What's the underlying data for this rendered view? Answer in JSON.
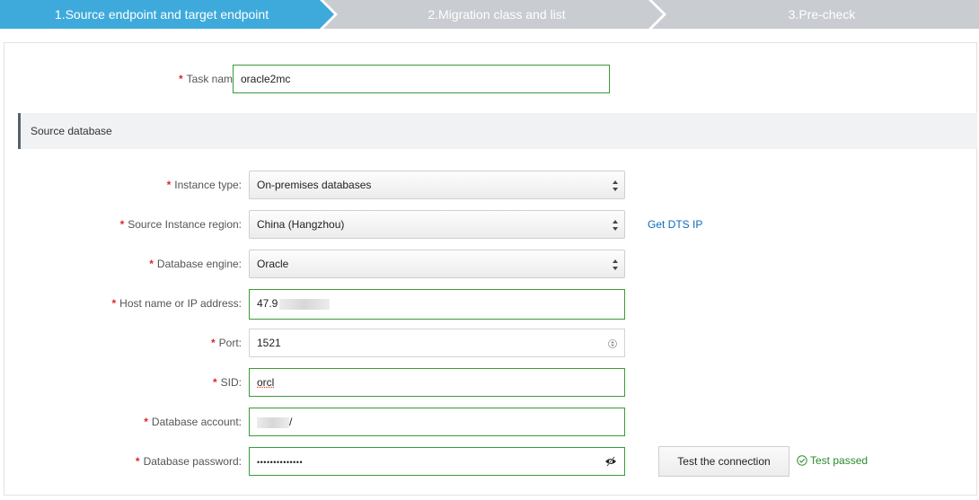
{
  "steps": [
    {
      "label": "1.Source endpoint and target endpoint",
      "state": "active"
    },
    {
      "label": "2.Migration class and list",
      "state": "inactive"
    },
    {
      "label": "3.Pre-check",
      "state": "inactive"
    }
  ],
  "colors": {
    "step_active": "#3eaadb",
    "step_inactive": "#c9ccd1",
    "ok_border": "#3a9b3a",
    "link": "#0a6bbf",
    "required": "#e0262b"
  },
  "form": {
    "required_mark": "*",
    "task_name": {
      "label": "Task name:",
      "value": "oracle2mc"
    },
    "section_title": "Source database",
    "instance_type": {
      "label": "Instance type:",
      "value": "On-premises databases"
    },
    "region": {
      "label": "Source Instance region:",
      "value": "China (Hangzhou)",
      "link": "Get DTS IP"
    },
    "engine": {
      "label": "Database engine:",
      "value": "Oracle"
    },
    "host": {
      "label": "Host name or IP address:",
      "value": "47.9"
    },
    "port": {
      "label": "Port:",
      "value": "1521"
    },
    "sid": {
      "label": "SID:",
      "value": "orcl"
    },
    "account": {
      "label": "Database account:",
      "value": "/"
    },
    "password": {
      "label": "Database password:",
      "value": "••••••••••••••"
    },
    "test_button": "Test the connection",
    "test_status": "Test passed"
  }
}
